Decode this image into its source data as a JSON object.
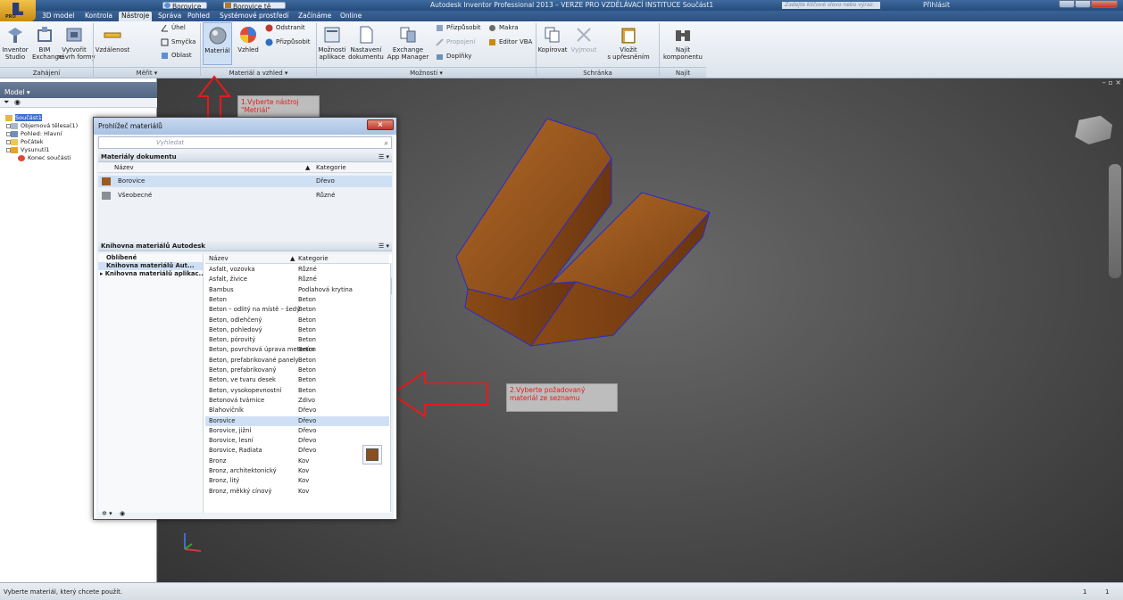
{
  "titlebar": {
    "window_title": "Autodesk Inventor Professional 2013 – VERZE PRO VZDĚLÁVACÍ INSTITUCE   Součást1",
    "qat_material": "Borovice",
    "qat_appearance": "Borovice tě",
    "search_placeholder": "Zadejte klíčové slovo nebo výraz.",
    "signin_label": "Přihlásit",
    "pro_badge": "PRO"
  },
  "tabs": [
    {
      "label": "3D model"
    },
    {
      "label": "Kontrola"
    },
    {
      "label": "Nástroje"
    },
    {
      "label": "Správa"
    },
    {
      "label": "Pohled"
    },
    {
      "label": "Systémové prostředí"
    },
    {
      "label": "Začínáme"
    },
    {
      "label": "Online"
    }
  ],
  "ribbon": {
    "groups": {
      "start": "Zahájení",
      "measure": "Měřit ▾",
      "material": "Materiál a vzhled ▾",
      "options": "Možnosti ▾",
      "clipboard": "Schránka",
      "find": "Najít"
    },
    "buttons": {
      "inventor_studio": "Inventor\nStudio",
      "bim": "BIM\nExchange",
      "create_form": "Vytvořit\nnávrh formy",
      "distance": "Vzdálenost",
      "angle": "Úhel",
      "loop": "Smyčka",
      "area": "Oblast",
      "material": "Materiál",
      "appearance": "Vzhled",
      "remove": "Odstranit",
      "adjust": "Přizpůsobit",
      "app_options": "Možnosti\naplikace",
      "doc_settings": "Nastavení\ndokumentu",
      "exchange": "Exchange\nApp Manager",
      "customize": "Přizpůsobit",
      "macros": "Makra",
      "vba": "Editor VBA",
      "connect": "Propojení",
      "addins": "Doplňky",
      "copy": "Kopírovat",
      "cut": "Vyjmout",
      "paste_special": "Vložit\ns upřesněním",
      "find_component": "Najít\nkomponentu"
    }
  },
  "browser": {
    "title": "Model ▾",
    "tree": [
      {
        "label": "Součást1"
      },
      {
        "label": "Objemová tělesa(1)"
      },
      {
        "label": "Pohled: Hlavní"
      },
      {
        "label": "Počátek"
      },
      {
        "label": "Vysunutí1"
      },
      {
        "label": "Konec součásti"
      }
    ]
  },
  "dialog": {
    "title": "Prohlížeč materiálů",
    "search_placeholder": "Vyhledat",
    "doc_section": "Materiály dokumentu",
    "col_name": "Název",
    "col_category": "Kategorie",
    "doc_materials": [
      {
        "name": "Borovice",
        "category": "Dřevo",
        "color": "#9a5a22"
      },
      {
        "name": "Všeobecné",
        "category": "Různé",
        "color": "#8a8f96"
      }
    ],
    "lib_section": "Knihovna materiálů Autodesk",
    "lib_tree": [
      {
        "label": "Oblíbené"
      },
      {
        "label": "Knihovna materiálů Aut..."
      },
      {
        "label": "▸ Knihovna materiálů aplikac..."
      }
    ],
    "lib_materials": [
      {
        "name": "Asfalt, vozovka",
        "category": "Různé"
      },
      {
        "name": "Asfalt, živice",
        "category": "Různé"
      },
      {
        "name": "Bambus",
        "category": "Podlahová krytina"
      },
      {
        "name": "Beton",
        "category": "Beton"
      },
      {
        "name": "Beton – odlitý na místě – šedý",
        "category": "Beton"
      },
      {
        "name": "Beton, odlehčený",
        "category": "Beton"
      },
      {
        "name": "Beton, pohledový",
        "category": "Beton"
      },
      {
        "name": "Beton, pórovitý",
        "category": "Beton"
      },
      {
        "name": "Beton, povrchová úprava metením",
        "category": "Beton"
      },
      {
        "name": "Beton, prefabrikované panely",
        "category": "Beton"
      },
      {
        "name": "Beton, prefabrikovaný",
        "category": "Beton"
      },
      {
        "name": "Beton, ve tvaru desek",
        "category": "Beton"
      },
      {
        "name": "Beton, vysokopevnostní",
        "category": "Beton"
      },
      {
        "name": "Betonová tvárnice",
        "category": "Zdivo"
      },
      {
        "name": "Blahovičník",
        "category": "Dřevo"
      },
      {
        "name": "Borovice",
        "category": "Dřevo"
      },
      {
        "name": "Borovice, jižní",
        "category": "Dřevo"
      },
      {
        "name": "Borovice, lesní",
        "category": "Dřevo"
      },
      {
        "name": "Borovice, Radiata",
        "category": "Dřevo"
      },
      {
        "name": "Bronz",
        "category": "Kov"
      },
      {
        "name": "Bronz, architektonický",
        "category": "Kov"
      },
      {
        "name": "Bronz, litý",
        "category": "Kov"
      },
      {
        "name": "Bronz, měkký cínový",
        "category": "Kov"
      }
    ],
    "selected_lib_index": 15
  },
  "annotations": {
    "step1": "1.Vyberte nástroj \"Metriál\"",
    "step2": "2.Vyberte požadovaný materiál ze seznamu"
  },
  "status": {
    "message": "Vyberte materiál, který chcete použít.",
    "count_a": "1",
    "count_b": "1"
  },
  "colors": {
    "wood": "#9a5a22",
    "annotation_red": "#e41b1b",
    "selection": "#cfe0f5"
  }
}
